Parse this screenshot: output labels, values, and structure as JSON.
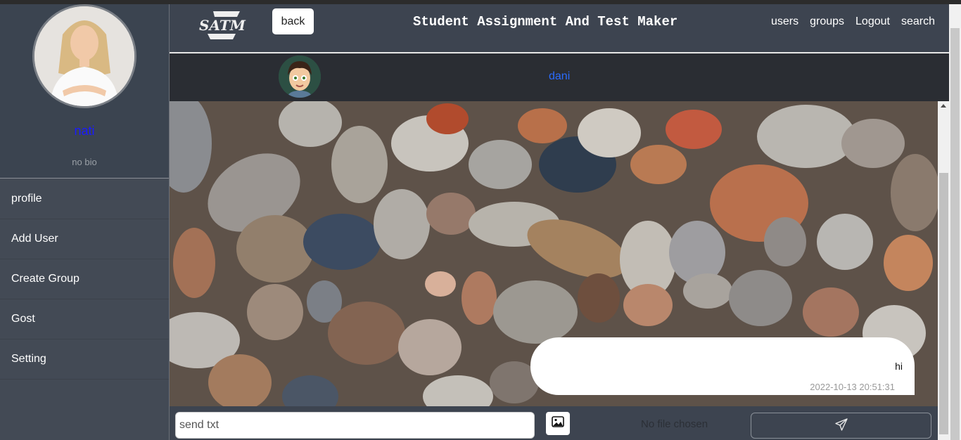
{
  "app": {
    "title": "Student Assignment And Test Maker",
    "back_label": "back"
  },
  "nav": [
    "users",
    "groups",
    "Logout",
    "search"
  ],
  "profile": {
    "name": "nati",
    "bio": "no bio"
  },
  "sidebar": {
    "items": [
      {
        "label": "profile"
      },
      {
        "label": "Add User"
      },
      {
        "label": "Create Group"
      },
      {
        "label": "Gost"
      },
      {
        "label": "Setting"
      }
    ]
  },
  "chat": {
    "contact_name": "dani",
    "messages": [
      {
        "text": "hi",
        "time": "2022-10-13 20:51:31"
      }
    ]
  },
  "composer": {
    "placeholder": "send txt",
    "file_status": "No file chosen"
  },
  "icons": {
    "logo": "satm-logo",
    "image": "image-icon",
    "send": "send-icon"
  }
}
